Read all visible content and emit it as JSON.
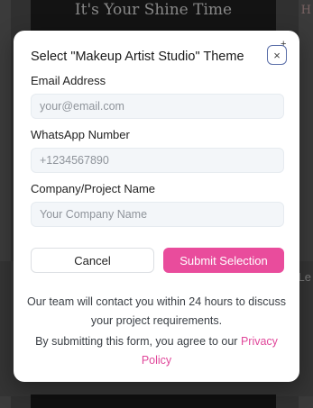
{
  "background": {
    "hero_text": "It's Your Shine Time",
    "right_letter_top": "H",
    "right_letter_mid": "Le"
  },
  "modal": {
    "title": "Select \"Makeup Artist Studio\" Theme",
    "close_glyph": "×",
    "fields": {
      "email": {
        "label": "Email Address",
        "placeholder": "your@email.com"
      },
      "whatsapp": {
        "label": "WhatsApp Number",
        "placeholder": "+1234567890"
      },
      "company": {
        "label": "Company/Project Name",
        "placeholder": "Your Company Name"
      }
    },
    "buttons": {
      "cancel": "Cancel",
      "submit": "Submit Selection"
    },
    "contact_note": "Our team will contact you within 24 hours to discuss your project requirements.",
    "agreement_prefix": "By submitting this form, you agree to our ",
    "privacy_link": "Privacy Policy"
  },
  "colors": {
    "accent": "#e94c9c",
    "link": "#e0479a",
    "input_bg": "#f3f6f9"
  }
}
